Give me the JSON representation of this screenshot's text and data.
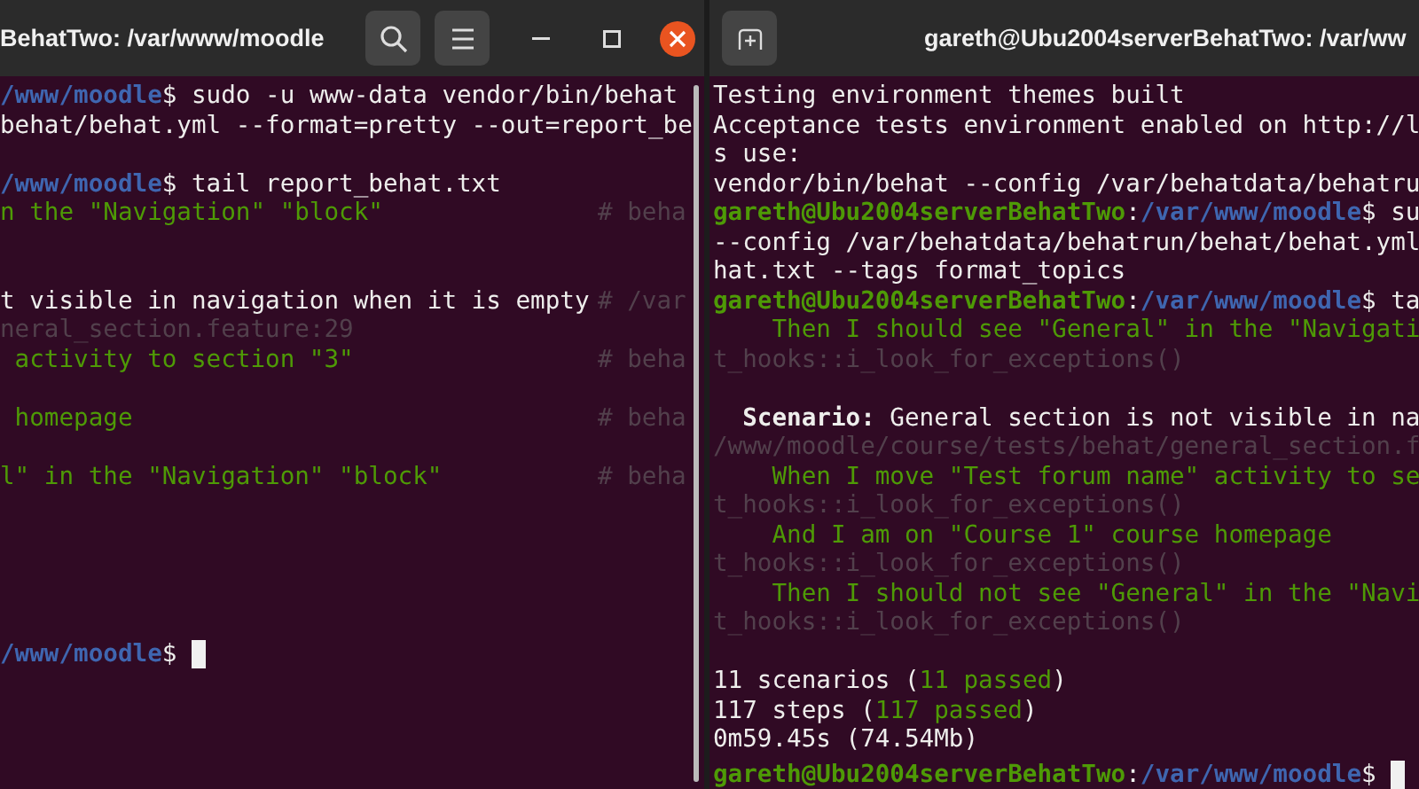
{
  "windows": [
    {
      "title_bar": [
        {
          "kind": "title",
          "text": "BehatTwo: /var/www/moodle"
        },
        {
          "kind": "search"
        },
        {
          "kind": "menu"
        },
        {
          "kind": "minimize"
        },
        {
          "kind": "maximize"
        },
        {
          "kind": "close"
        }
      ],
      "scrollbar": true,
      "lines": [
        {
          "segments": [
            {
              "kind": "path",
              "text": "/www/moodle"
            },
            {
              "kind": "plain",
              "text": "$ sudo -u www-data vendor/bin/behat"
            }
          ]
        },
        {
          "segments": [
            {
              "kind": "plain",
              "text": "behat/behat.yml --format=pretty --out=report_be"
            }
          ]
        },
        {
          "gap_before": true,
          "segments": [
            {
              "kind": "path",
              "text": "/www/moodle"
            },
            {
              "kind": "plain",
              "text": "$ tail report_behat.txt"
            }
          ]
        },
        {
          "segments": [
            {
              "kind": "step",
              "text": "n the \"Navigation\" \"block\""
            }
          ],
          "comment": "# beha"
        },
        {
          "wide_gap_before": true,
          "segments": [
            {
              "kind": "plain",
              "text": "t visible in navigation when it is empty"
            }
          ],
          "comment": "# /var"
        },
        {
          "segments": [
            {
              "kind": "comment",
              "text": "neral_section.feature:29"
            }
          ]
        },
        {
          "segments": [
            {
              "kind": "step",
              "text": " activity to section \"3\""
            }
          ],
          "comment": "# beha"
        },
        {
          "gap_before": true,
          "segments": [
            {
              "kind": "step",
              "text": " homepage"
            }
          ],
          "comment": "# beha"
        },
        {
          "gap_before": true,
          "segments": [
            {
              "kind": "step",
              "text": "l\" in the \"Navigation\" \"block\""
            }
          ],
          "comment": "# beha"
        },
        {
          "segments": [
            {
              "kind": "path",
              "text": "/www/moodle"
            },
            {
              "kind": "plain",
              "text": "$"
            }
          ],
          "cursor": true
        }
      ]
    },
    {
      "title_bar": [
        {
          "kind": "new-tab"
        },
        {
          "kind": "title",
          "text": "gareth@Ubu2004serverBehatTwo: /var/ww"
        }
      ],
      "lines": [
        {
          "segments": [
            {
              "kind": "plain",
              "text": "Testing environment themes built"
            }
          ]
        },
        {
          "segments": [
            {
              "kind": "plain",
              "text": "Acceptance tests environment enabled on http://l"
            }
          ]
        },
        {
          "segments": [
            {
              "kind": "plain",
              "text": "s use:"
            }
          ]
        },
        {
          "segments": [
            {
              "kind": "plain",
              "text": "vendor/bin/behat --config /var/behatdata/behatru"
            }
          ]
        },
        {
          "segments": [
            {
              "kind": "user",
              "text": "gareth@Ubu2004serverBehatTwo"
            },
            {
              "kind": "plain",
              "text": ":"
            },
            {
              "kind": "path",
              "text": "/var/www/moodle"
            },
            {
              "kind": "plain",
              "text": "$ su"
            }
          ]
        },
        {
          "segments": [
            {
              "kind": "plain",
              "text": "--config /var/behatdata/behatrun/behat/behat.yml"
            }
          ]
        },
        {
          "segments": [
            {
              "kind": "plain",
              "text": "hat.txt --tags format_topics"
            }
          ]
        },
        {
          "segments": [
            {
              "kind": "user",
              "text": "gareth@Ubu2004serverBehatTwo"
            },
            {
              "kind": "plain",
              "text": ":"
            },
            {
              "kind": "path",
              "text": "/var/www/moodle"
            },
            {
              "kind": "plain",
              "text": "$ ta"
            }
          ]
        },
        {
          "segments": [
            {
              "kind": "step",
              "text": "    Then I should see \"General\" in the \"Navigati"
            }
          ]
        },
        {
          "segments": [
            {
              "kind": "comment",
              "text": "t_hooks::i_look_for_exceptions()"
            }
          ]
        },
        {
          "gap_before": true,
          "segments": [
            {
              "kind": "bold",
              "text": "  Scenario:"
            },
            {
              "kind": "plain",
              "text": " General section is not visible in na"
            }
          ]
        },
        {
          "segments": [
            {
              "kind": "comment",
              "text": "/www/moodle/course/tests/behat/general_section.f"
            }
          ]
        },
        {
          "segments": [
            {
              "kind": "step",
              "text": "    When I move \"Test forum name\" activity to se"
            }
          ]
        },
        {
          "segments": [
            {
              "kind": "comment",
              "text": "t_hooks::i_look_for_exceptions()"
            }
          ]
        },
        {
          "segments": [
            {
              "kind": "step",
              "text": "    And I am on \"Course 1\" course homepage"
            }
          ]
        },
        {
          "segments": [
            {
              "kind": "comment",
              "text": "t_hooks::i_look_for_exceptions()"
            }
          ]
        },
        {
          "segments": [
            {
              "kind": "step",
              "text": "    Then I should not see \"General\" in the \"Navi"
            }
          ]
        },
        {
          "segments": [
            {
              "kind": "comment",
              "text": "t_hooks::i_look_for_exceptions()"
            }
          ]
        },
        {
          "gap_before": true,
          "segments": [
            {
              "kind": "plain",
              "text": "11 scenarios ("
            },
            {
              "kind": "step",
              "text": "11 passed"
            },
            {
              "kind": "plain",
              "text": ")"
            }
          ]
        },
        {
          "segments": [
            {
              "kind": "plain",
              "text": "117 steps ("
            },
            {
              "kind": "step",
              "text": "117 passed"
            },
            {
              "kind": "plain",
              "text": ")"
            }
          ]
        },
        {
          "segments": [
            {
              "kind": "plain",
              "text": "0m59.45s (74.54Mb)"
            }
          ]
        },
        {
          "segments": [
            {
              "kind": "user",
              "text": "gareth@Ubu2004serverBehatTwo"
            },
            {
              "kind": "plain",
              "text": ":"
            },
            {
              "kind": "path",
              "text": "/var/www/moodle"
            },
            {
              "kind": "plain",
              "text": "$"
            }
          ],
          "cursor": true
        }
      ]
    }
  ]
}
